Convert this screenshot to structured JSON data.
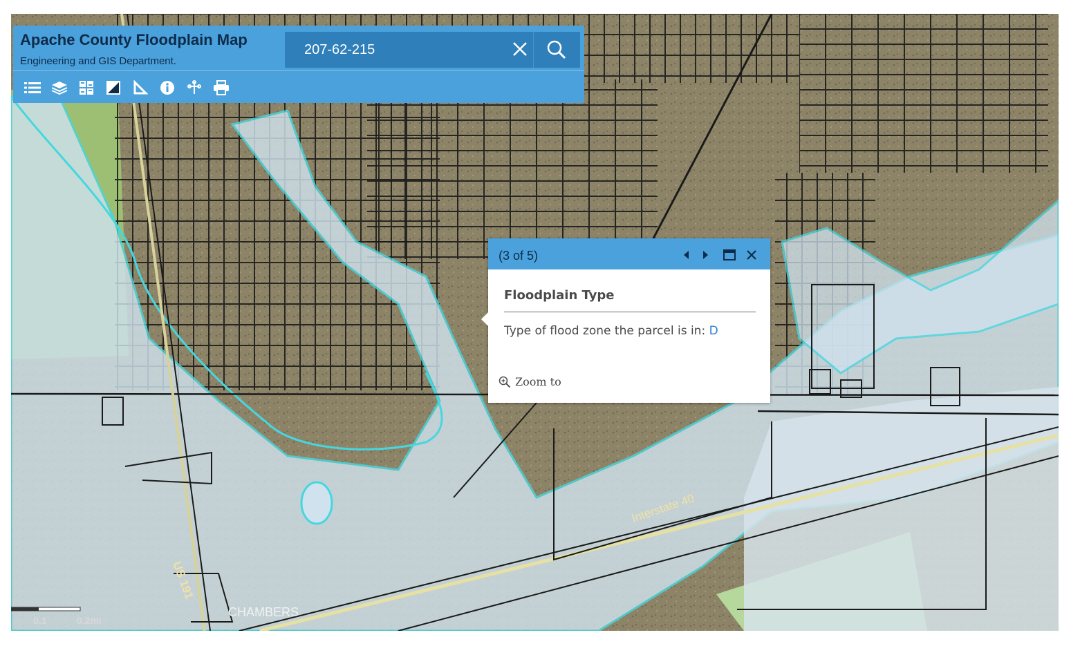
{
  "header": {
    "title": "Apache County Floodplain Map",
    "subtitle": "Engineering and GIS Department."
  },
  "search": {
    "value": "207-62-215",
    "clear_icon": "close-icon",
    "search_icon": "search-icon"
  },
  "toolbar": {
    "tools": [
      {
        "icon": "list-icon"
      },
      {
        "icon": "layers-icon"
      },
      {
        "icon": "basemap-gallery-icon"
      },
      {
        "icon": "legend-icon"
      },
      {
        "icon": "measure-icon"
      },
      {
        "icon": "info-icon"
      },
      {
        "icon": "draw-icon"
      },
      {
        "icon": "print-icon"
      }
    ]
  },
  "popup": {
    "counter": "(3 of 5)",
    "heading": "Floodplain Type",
    "field_label": "Type of flood zone the parcel is in:",
    "field_value": "D",
    "zoom_label": "Zoom to"
  },
  "map": {
    "labels": {
      "interstate": "Interstate 40",
      "highway": "US 191",
      "town": "CHAMBERS"
    },
    "scale": {
      "tick1": "0.1",
      "tick2": "0.2mi"
    }
  },
  "colors": {
    "panel": "#4aa1db",
    "panel_dark": "#2f7fba",
    "floodplain_fill": "#cfe2ee",
    "floodplain_edge": "#45d7e0",
    "green_zone": "#b6d89c"
  }
}
